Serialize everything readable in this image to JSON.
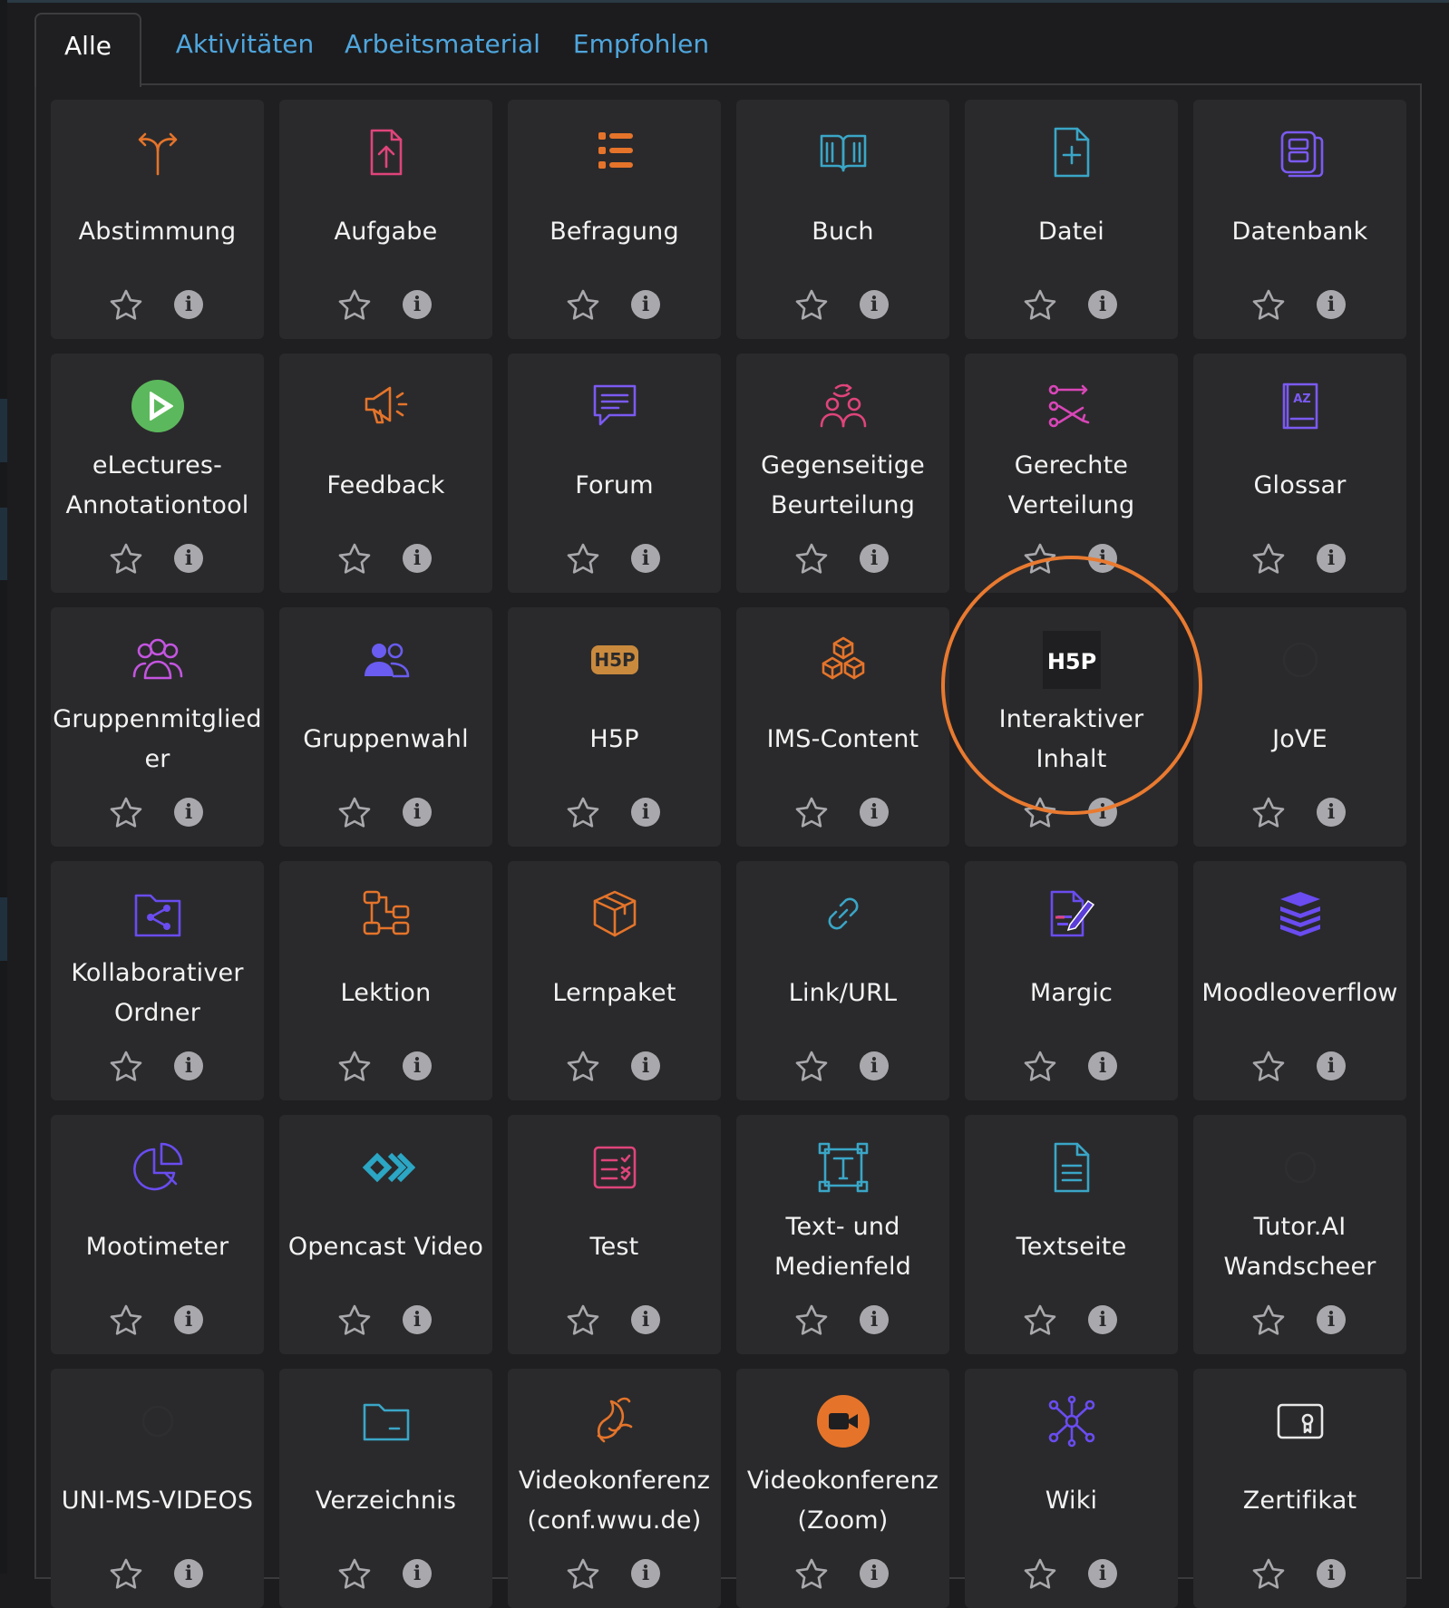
{
  "tabs": [
    {
      "label": "Alle",
      "active": true
    },
    {
      "label": "Aktivitäten",
      "active": false
    },
    {
      "label": "Arbeitsmaterial",
      "active": false
    },
    {
      "label": "Empfohlen",
      "active": false
    }
  ],
  "info_glyph": "i",
  "highlighted_module": "Interaktiver Inhalt",
  "highlight_color": "#e97a30",
  "modules": [
    {
      "name": "Abstimmung",
      "icon": "choice-arrows-icon",
      "color": "#e5742a"
    },
    {
      "name": "Aufgabe",
      "icon": "assignment-upload-icon",
      "color": "#e0447a"
    },
    {
      "name": "Befragung",
      "icon": "survey-list-icon",
      "color": "#e5742a"
    },
    {
      "name": "Buch",
      "icon": "book-icon",
      "color": "#3aa6c7"
    },
    {
      "name": "Datei",
      "icon": "file-plus-icon",
      "color": "#3aa6c7"
    },
    {
      "name": "Datenbank",
      "icon": "database-icon",
      "color": "#7b5af2"
    },
    {
      "name": "eLectures-Annotationtool",
      "icon": "play-circle-icon",
      "color": "#5cb85c"
    },
    {
      "name": "Feedback",
      "icon": "megaphone-icon",
      "color": "#e5742a"
    },
    {
      "name": "Forum",
      "icon": "chat-bubble-icon",
      "color": "#7b5af2"
    },
    {
      "name": "Gegenseitige Beurteilung",
      "icon": "peer-review-icon",
      "color": "#e0447a"
    },
    {
      "name": "Gerechte Verteilung",
      "icon": "distribution-icon",
      "color": "#d946b8"
    },
    {
      "name": "Glossar",
      "icon": "glossary-icon",
      "color": "#7b5af2"
    },
    {
      "name": "Gruppenmitglieder",
      "icon": "group-members-icon",
      "color": "#c455e0"
    },
    {
      "name": "Gruppenwahl",
      "icon": "group-choice-icon",
      "color": "#6a5cf0"
    },
    {
      "name": "H5P",
      "icon": "h5p-badge-icon",
      "color": "#c98a3e"
    },
    {
      "name": "IMS-Content",
      "icon": "cubes-icon",
      "color": "#e5742a"
    },
    {
      "name": "Interaktiver Inhalt",
      "icon": "h5p-logo-icon",
      "color": "#ffffff"
    },
    {
      "name": "JoVE",
      "icon": "jove-logo-icon",
      "color": "#2e2e30"
    },
    {
      "name": "Kollaborativer Ordner",
      "icon": "shared-folder-icon",
      "color": "#6a4cf0"
    },
    {
      "name": "Lektion",
      "icon": "lesson-flow-icon",
      "color": "#e5742a"
    },
    {
      "name": "Lernpaket",
      "icon": "package-box-icon",
      "color": "#e5742a"
    },
    {
      "name": "Link/URL",
      "icon": "link-icon",
      "color": "#3aa6c7"
    },
    {
      "name": "Margic",
      "icon": "margic-doc-pen-icon",
      "color": "#6a4cf0"
    },
    {
      "name": "Moodleoverflow",
      "icon": "stack-icon",
      "color": "#6a4cf0"
    },
    {
      "name": "Mootimeter",
      "icon": "pie-chart-icon",
      "color": "#6a4cf0"
    },
    {
      "name": "Opencast Video",
      "icon": "opencast-logo-icon",
      "color": "#2ba6c4"
    },
    {
      "name": "Test",
      "icon": "quiz-checklist-icon",
      "color": "#e0447a"
    },
    {
      "name": "Text- und Medienfeld",
      "icon": "text-frame-icon",
      "color": "#3aa6c7"
    },
    {
      "name": "Textseite",
      "icon": "text-page-icon",
      "color": "#3aa6c7"
    },
    {
      "name": "Tutor.AI Wandscheer",
      "icon": "tutor-logo-icon",
      "color": "#2e2e30"
    },
    {
      "name": "UNI-MS-VIDEOS",
      "icon": "video-logo-icon",
      "color": "#2e2e30"
    },
    {
      "name": "Verzeichnis",
      "icon": "folder-icon",
      "color": "#3aa6c7"
    },
    {
      "name": "Videokonferenz (conf.wwu.de)",
      "icon": "jitsi-logo-icon",
      "color": "#e5742a"
    },
    {
      "name": "Videokonferenz (Zoom)",
      "icon": "zoom-camera-icon",
      "color": "#e5742a"
    },
    {
      "name": "Wiki",
      "icon": "wiki-network-icon",
      "color": "#6a4cf0"
    },
    {
      "name": "Zertifikat",
      "icon": "certificate-icon",
      "color": "#e8e8e8"
    }
  ]
}
